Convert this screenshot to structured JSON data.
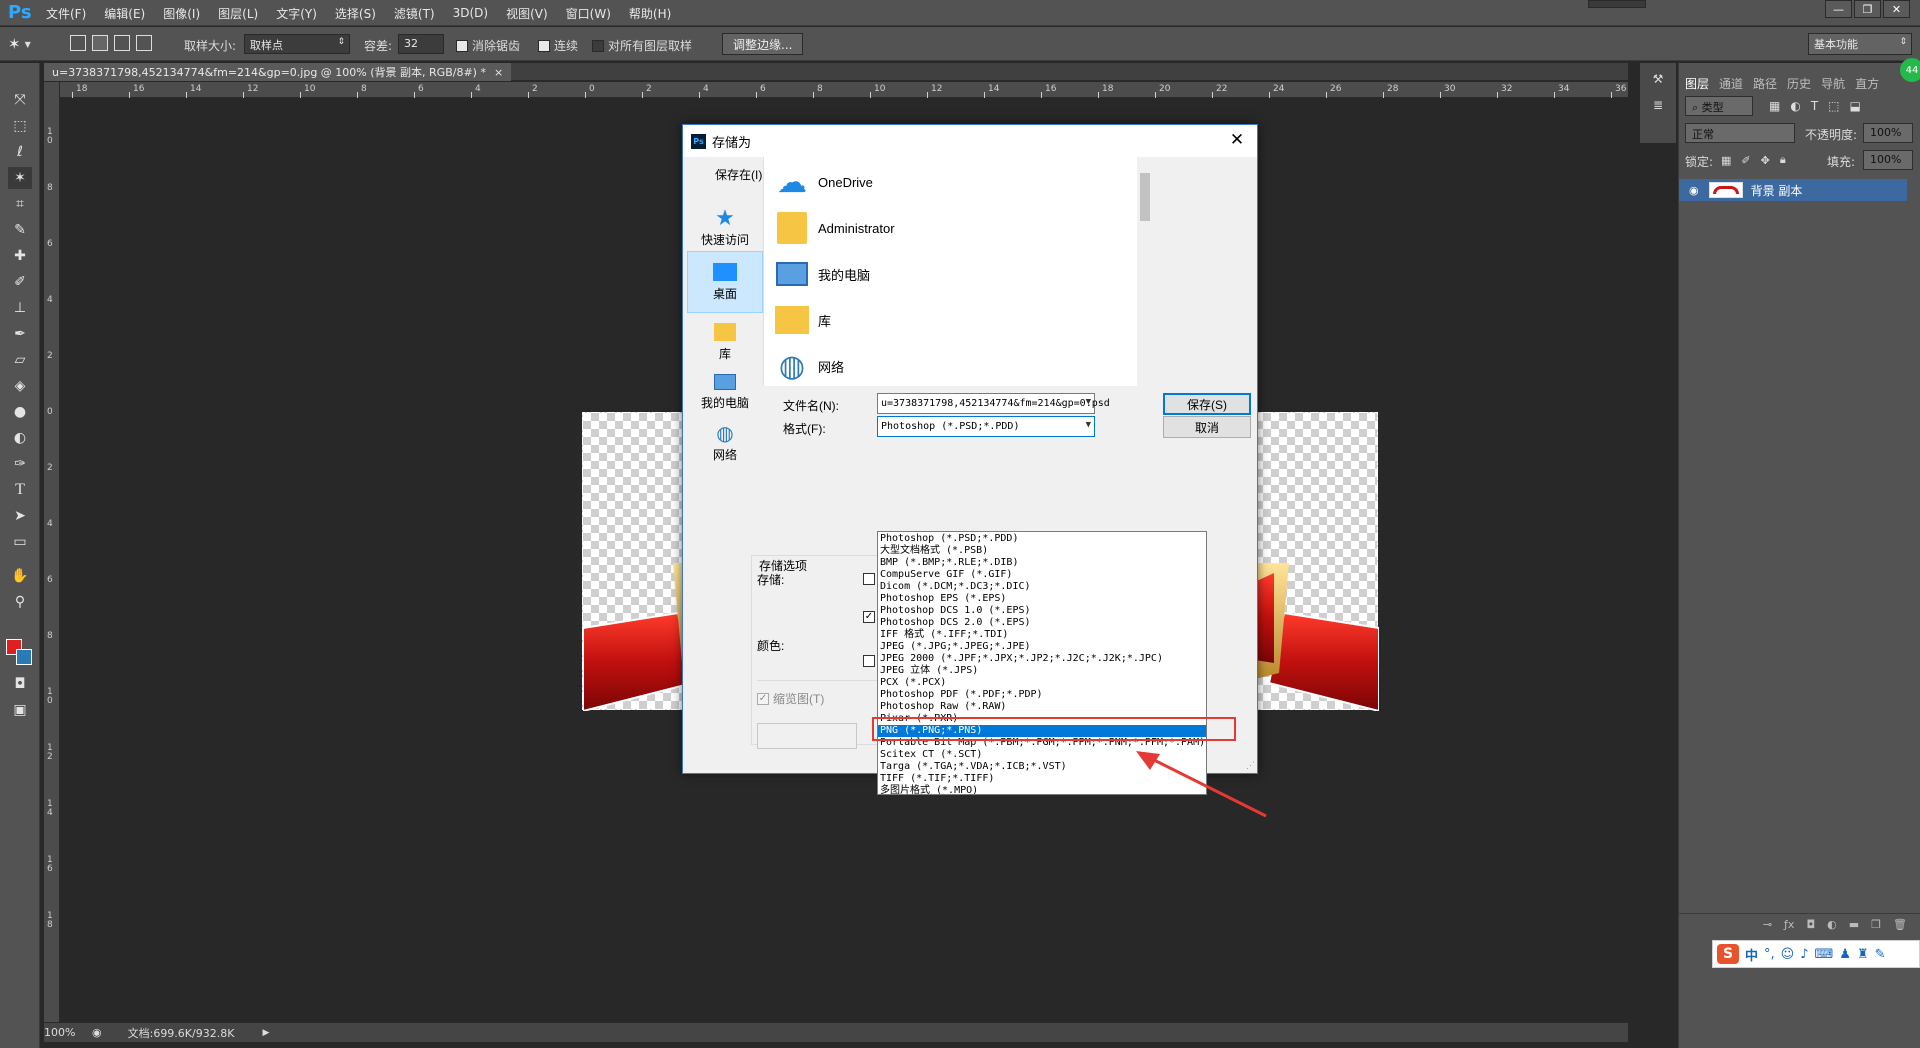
{
  "app": {
    "logo": "Ps",
    "menus": [
      "文件(F)",
      "编辑(E)",
      "图像(I)",
      "图层(L)",
      "文字(Y)",
      "选择(S)",
      "滤镜(T)",
      "3D(D)",
      "视图(V)",
      "窗口(W)",
      "帮助(H)"
    ],
    "window_controls": [
      "—",
      "❐",
      "✕"
    ]
  },
  "options": {
    "sample_size_label": "取样大小:",
    "sample_size_value": "取样点",
    "tolerance_label": "容差:",
    "tolerance_value": "32",
    "antialias_label": "消除锯齿",
    "contiguous_label": "连续",
    "all_layers_label": "对所有图层取样",
    "refine_edge_label": "调整边缘...",
    "workspace": "基本功能"
  },
  "document": {
    "tab_title": "u=3738371798,452134774&fm=214&gp=0.jpg @ 100% (背景 副本, RGB/8#) *",
    "zoom": "100%",
    "doc_size": "文档:699.6K/932.8K"
  },
  "rulers": {
    "h_ticks": [
      "18",
      "16",
      "14",
      "12",
      "10",
      "8",
      "6",
      "4",
      "2",
      "0",
      "2",
      "4",
      "6",
      "8",
      "10",
      "12",
      "14",
      "16",
      "18",
      "20",
      "22",
      "24",
      "26",
      "28",
      "30",
      "32",
      "34",
      "36"
    ],
    "v_ticks": [
      "1 0",
      "8",
      "6",
      "4",
      "2",
      "0",
      "2",
      "4",
      "6",
      "8",
      "1 0",
      "1 2",
      "1 4",
      "1 6",
      "1 8"
    ]
  },
  "layers_panel": {
    "tabs": [
      "图层",
      "通道",
      "路径",
      "历史",
      "导航",
      "直方"
    ],
    "filter_kind": "类型",
    "blend_mode": "正常",
    "opacity_label": "不透明度:",
    "opacity_value": "100%",
    "lock_label": "锁定:",
    "fill_label": "填充:",
    "fill_value": "100%",
    "layer_name": "背景 副本"
  },
  "ime": {
    "mode": "中",
    "punct": "°,"
  },
  "dialog": {
    "title": "存储为",
    "save_in_label": "保存在(I):",
    "save_in_value": "桌面",
    "places": [
      "快速访问",
      "桌面",
      "库",
      "我的电脑",
      "网络"
    ],
    "files": [
      "OneDrive",
      "Administrator",
      "我的电脑",
      "库",
      "网络"
    ],
    "filename_label": "文件名(N):",
    "filename_value": "u=3738371798,452134774&fm=214&gp=0.psd",
    "format_label": "格式(F):",
    "format_value": "Photoshop (*.PSD;*.PDD)",
    "save_button": "保存(S)",
    "cancel_button": "取消",
    "save_options_label": "存储选项",
    "store_label": "存储:",
    "color_label": "颜色:",
    "thumbnail_label": "缩览图(T)",
    "format_options": [
      "Photoshop (*.PSD;*.PDD)",
      "大型文档格式 (*.PSB)",
      "BMP (*.BMP;*.RLE;*.DIB)",
      "CompuServe GIF (*.GIF)",
      "Dicom (*.DCM;*.DC3;*.DIC)",
      "Photoshop EPS (*.EPS)",
      "Photoshop DCS 1.0 (*.EPS)",
      "Photoshop DCS 2.0 (*.EPS)",
      "IFF 格式 (*.IFF;*.TDI)",
      "JPEG (*.JPG;*.JPEG;*.JPE)",
      "JPEG 2000 (*.JPF;*.JPX;*.JP2;*.J2C;*.J2K;*.JPC)",
      "JPEG 立体 (*.JPS)",
      "PCX (*.PCX)",
      "Photoshop PDF (*.PDF;*.PDP)",
      "Photoshop Raw (*.RAW)",
      "Pixar (*.PXR)",
      "PNG (*.PNG;*.PNS)",
      "Portable Bit Map (*.PBM;*.PGM;*.PPM;*.PNM;*.PFM;*.PAM)",
      "Scitex CT (*.SCT)",
      "Targa (*.TGA;*.VDA;*.ICB;*.VST)",
      "TIFF (*.TIF;*.TIFF)",
      "多图片格式 (*.MPO)"
    ],
    "highlighted_index": 16
  },
  "colors": {
    "annotation_red": "#e53935",
    "selection_blue": "#0078d7",
    "foreground_swatch": "#e02020",
    "background_swatch": "#2a7ab8"
  }
}
